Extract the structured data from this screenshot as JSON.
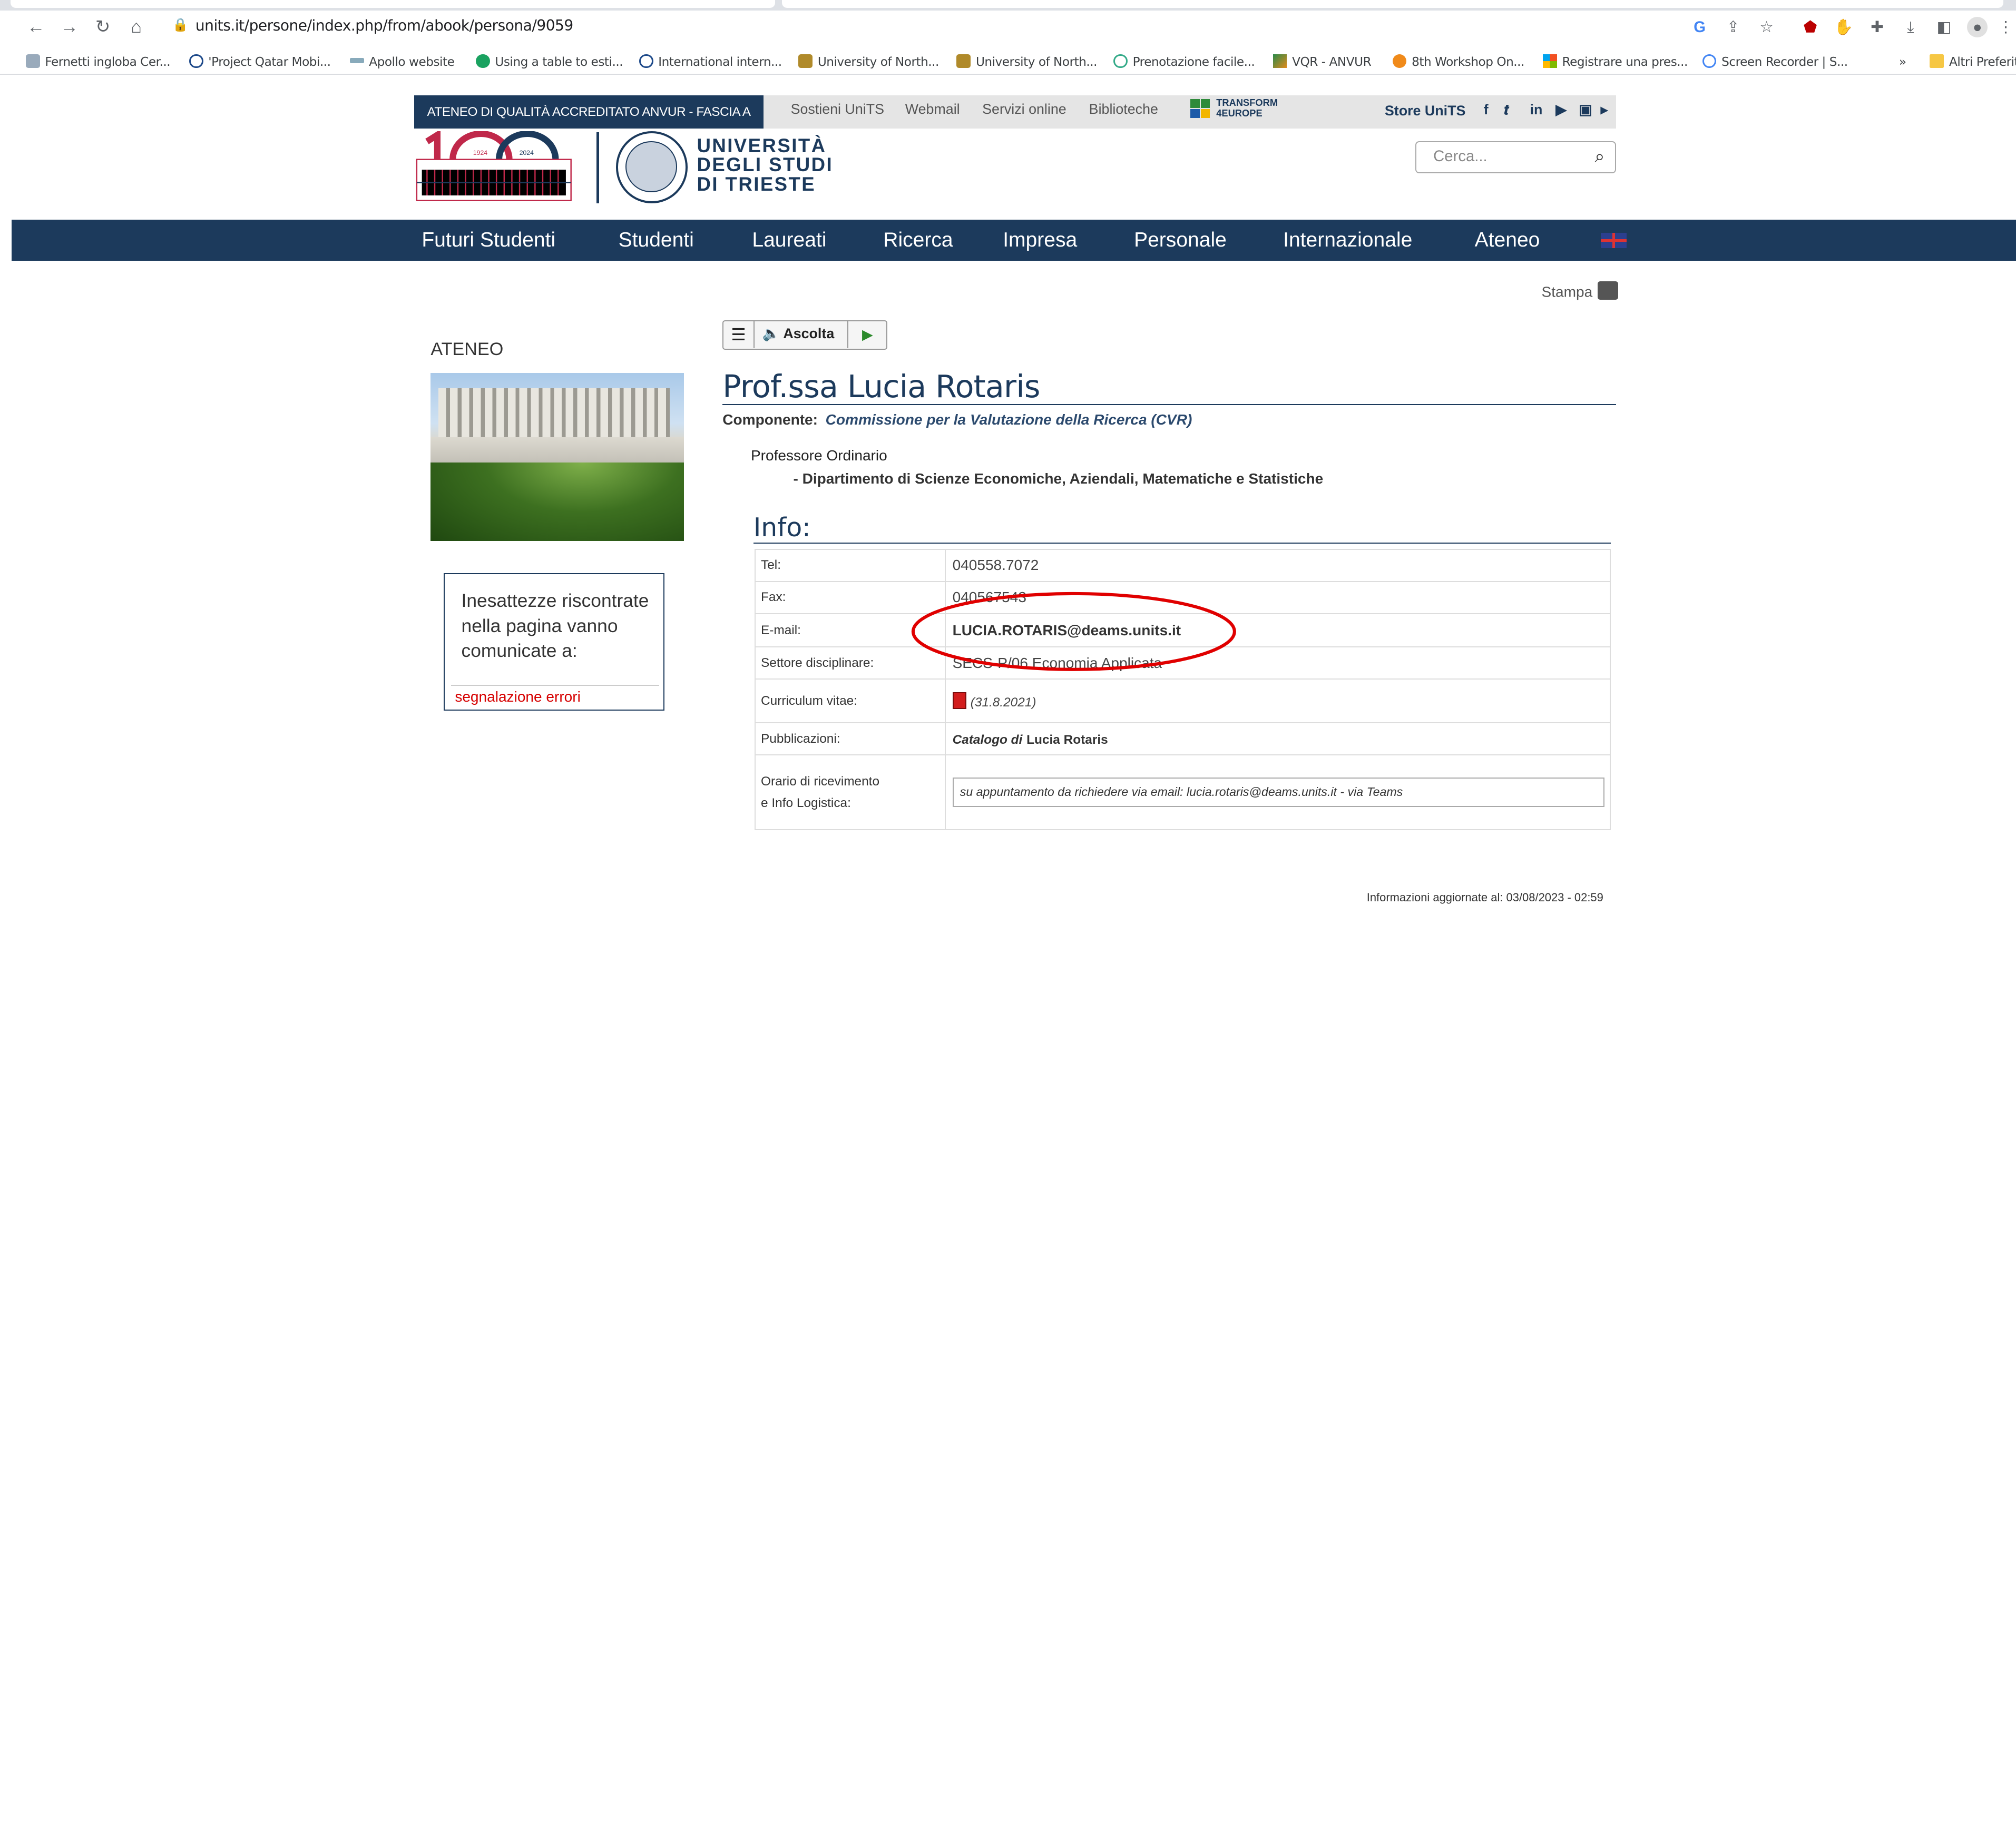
{
  "browser": {
    "url": "units.it/persone/index.php/from/abook/persona/9059",
    "nav_icons": [
      "back-icon",
      "forward-icon",
      "reload-icon",
      "home-icon"
    ],
    "bookmarks": [
      "Fernetti ingloba Cer...",
      "'Project Qatar Mobi...",
      "Apollo website",
      "Using a table to esti...",
      "International intern...",
      "University of North...",
      "University of North...",
      "Prenotazione facile...",
      "VQR - ANVUR",
      "8th Workshop On...",
      "Registrare una pres...",
      "Screen Recorder | S..."
    ],
    "more_bookmarks": "»",
    "other_bookmarks": "Altri Preferiti"
  },
  "site": {
    "accreditation": "ATENEO DI QUALITÀ ACCREDITATO ANVUR - FASCIA A",
    "top_links": [
      "Sostieni UniTS",
      "Webmail",
      "Servizi online",
      "Biblioteche"
    ],
    "transform_label": "TRANSFORM 4EUROPE",
    "store": "Store UniTS",
    "social": [
      "f",
      "𝒕",
      "in",
      "▶",
      "▣",
      "▸"
    ],
    "logo_years": [
      "1924",
      "2024"
    ],
    "university_name": [
      "UNIVERSITÀ",
      "DEGLI STUDI",
      "DI TRIESTE"
    ],
    "search_placeholder": "Cerca...",
    "nav": [
      "Futuri Studenti",
      "Studenti",
      "Laureati",
      "Ricerca",
      "Impresa",
      "Personale",
      "Internazionale",
      "Ateneo"
    ]
  },
  "page": {
    "sidebar_title": "ATENEO",
    "error_box_text": "Inesattezze riscontrate nella pagina vanno comunicate a:",
    "error_link": "segnalazione errori",
    "print_label": "Stampa",
    "listen_label": "Ascolta",
    "name": "Prof.ssa Lucia Rotaris",
    "component_label": "Componente:",
    "component_value": "Commissione per la Valutazione della Ricerca (CVR)",
    "role": "Professore Ordinario",
    "department": "- Dipartimento di Scienze Economiche, Aziendali, Matematiche e Statistiche",
    "info_title": "Info:",
    "info": {
      "tel_label": "Tel:",
      "tel": "040558.7072",
      "fax_label": "Fax:",
      "fax": "040567543",
      "email_label": "E-mail:",
      "email": "LUCIA.ROTARIS@deams.units.it",
      "sector_label": "Settore disciplinare:",
      "sector": "SECS-P/06 Economia Applicata",
      "cv_label": "Curriculum vitae:",
      "cv_date": "(31.8.2021)",
      "pubs_label": "Pubblicazioni:",
      "pubs_prefix": "Catalogo di",
      "pubs_name": "Lucia Rotaris",
      "hours_label_1": "Orario di ricevimento",
      "hours_label_2": "e Info Logistica:",
      "hours": "su appuntamento da richiedere via email: lucia.rotaris@deams.units.it - via Teams"
    },
    "updated": "Informazioni aggiornate al: 03/08/2023 - 02:59"
  },
  "annotation_color": "#e00000",
  "colors": {
    "brand": "#1c3a5c",
    "link_red": "#d60000"
  }
}
